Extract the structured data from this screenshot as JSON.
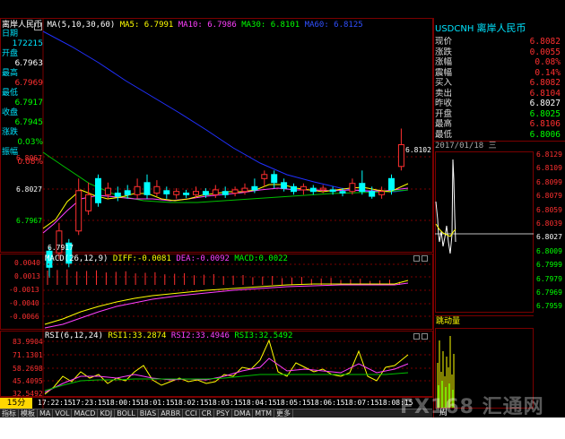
{
  "title": "离岸人民币",
  "indicator_line": {
    "ma_label": "MA(5,10,30,60)",
    "ma5": "MA5: 6.7991",
    "ma10": "MA10: 6.7986",
    "ma30": "MA30: 6.8101",
    "ma60": "MA60: 6.8125"
  },
  "left_panel": {
    "date_label": "日期",
    "date_value": "172215",
    "open_label": "开盘",
    "open_value": "6.7963",
    "high_label": "最高",
    "high_value": "6.7969",
    "low_label": "最低",
    "low_value": "6.7917",
    "close_label": "收盘",
    "close_value": "6.7945",
    "change_label": "涨跌",
    "change_value": "0.03%",
    "amp_label": "振幅",
    "amp_value": "0.08%"
  },
  "price_axis": {
    "top": "6.8067",
    "mid": "6.8027",
    "low": "6.7967"
  },
  "annotations": {
    "high_mark": "6.8102",
    "low_mark": "6.7917"
  },
  "macd": {
    "label": "MACD(26,12,9)",
    "diff": "DIFF:-0.0081",
    "dea": "DEA:-0.0092",
    "macd": "MACD:0.0022",
    "ticks": [
      "0.0040",
      "0.0013",
      "-0.0013",
      "-0.0040",
      "-0.0066"
    ]
  },
  "rsi": {
    "label": "RSI(6,12,24)",
    "rsi1": "RSI1:33.2874",
    "rsi2": "RSI2:33.4946",
    "rsi3": "RSI3:32.5492",
    "ticks": [
      "83.9904",
      "71.1301",
      "58.2698",
      "45.4095",
      "32.5492"
    ]
  },
  "period": "15分",
  "time_labels": [
    "17:22:15",
    "17:23:15",
    "18:00:15",
    "18:01:15",
    "18:02:15",
    "18:03:15",
    "18:04:15",
    "18:05:15",
    "18:06:15",
    "18:07:15",
    "18:08:15"
  ],
  "tabs": [
    "指标",
    "模板",
    "MA",
    "VOL",
    "MACD",
    "KDJ",
    "BOLL",
    "BIAS",
    "ARBR",
    "CCI",
    "CR",
    "PSY",
    "DMA",
    "MTM",
    "更多"
  ],
  "quote": {
    "symbol": "USDCNH",
    "name": "离岸人民币",
    "rows": [
      {
        "label": "现价",
        "value": "6.8082",
        "color": "#ff3030"
      },
      {
        "label": "涨跌",
        "value": "0.0055",
        "color": "#ff3030"
      },
      {
        "label": "涨幅",
        "value": "0.08%",
        "color": "#ff3030"
      },
      {
        "label": "震幅",
        "value": "0.14%",
        "color": "#ff3030"
      },
      {
        "label": "买入",
        "value": "6.8082",
        "color": "#ff3030"
      },
      {
        "label": "卖出",
        "value": "6.8104",
        "color": "#ff3030"
      },
      {
        "label": "昨收",
        "value": "6.8027",
        "color": "#ffffff"
      },
      {
        "label": "开盘",
        "value": "6.8025",
        "color": "#00ff00"
      },
      {
        "label": "最高",
        "value": "6.8106",
        "color": "#ff3030"
      },
      {
        "label": "最低",
        "value": "6.8006",
        "color": "#00ff00"
      }
    ]
  },
  "intraday": {
    "date": "2017/01/18 三",
    "ticks": [
      "6.8129",
      "6.8109",
      "6.8099",
      "6.8079",
      "6.8059",
      "6.8039",
      "6.8027",
      "6.8009",
      "6.7999",
      "6.7979",
      "6.7969",
      "6.7959"
    ],
    "vol_label": "跳动量",
    "week_label": "周"
  },
  "watermark": "FX168 汇通网"
}
